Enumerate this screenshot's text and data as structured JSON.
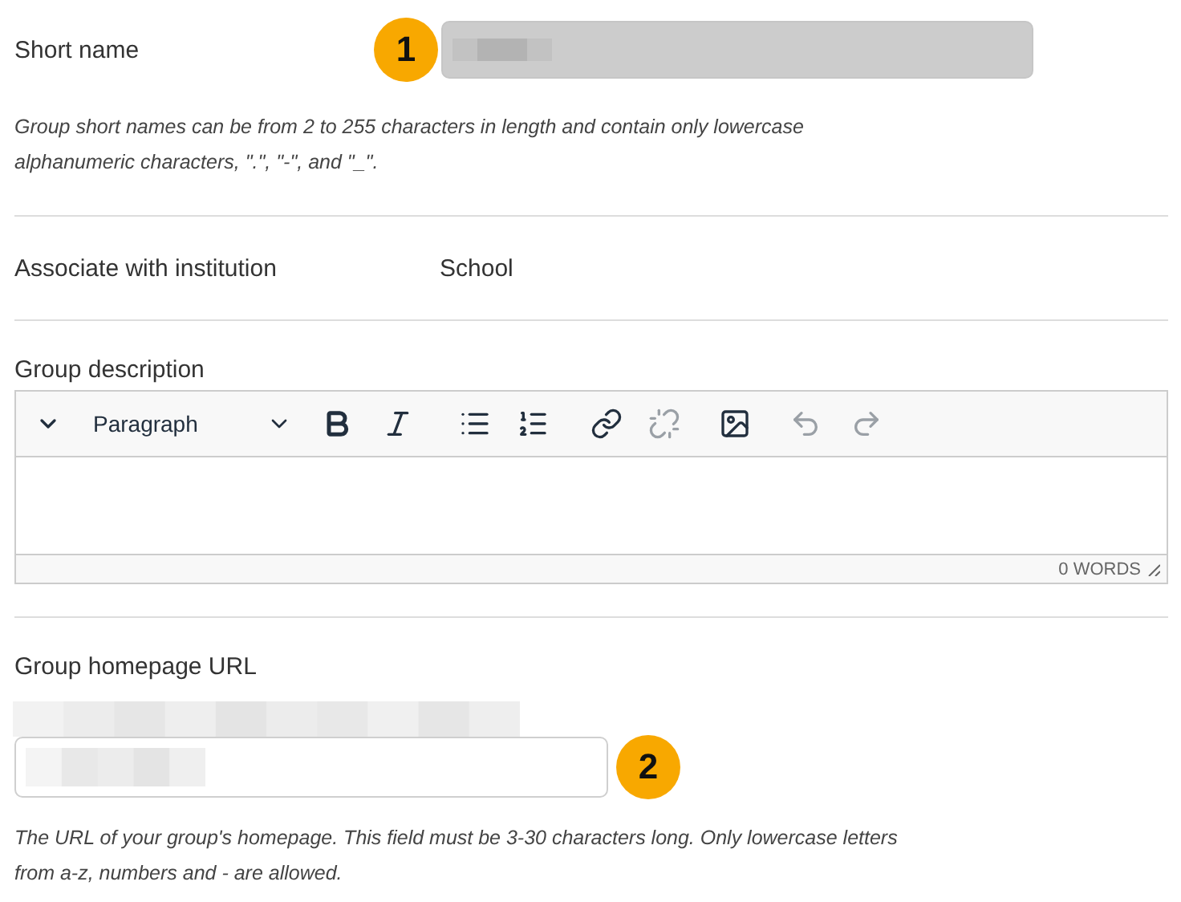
{
  "short_name": {
    "label": "Short name",
    "disabled": true,
    "callout": "1"
  },
  "short_name_help": "Group short names can be from 2 to 255 characters in length and contain only lowercase alphanumeric characters, \".\", \"-\", and \"_\".",
  "institution": {
    "label": "Associate with institution",
    "value": "School"
  },
  "description": {
    "label": "Group description",
    "toolbar": [
      {
        "kind": "collapse",
        "disabled": false
      },
      {
        "kind": "format",
        "label": "Paragraph",
        "disabled": false
      },
      {
        "kind": "bold",
        "disabled": false
      },
      {
        "kind": "italic",
        "disabled": false
      },
      {
        "kind": "bullets",
        "disabled": false
      },
      {
        "kind": "numbers",
        "disabled": false
      },
      {
        "kind": "link",
        "disabled": false
      },
      {
        "kind": "unlink",
        "disabled": true
      },
      {
        "kind": "image",
        "disabled": false
      },
      {
        "kind": "undo",
        "disabled": true
      },
      {
        "kind": "redo",
        "disabled": true
      }
    ],
    "word_count": "0 WORDS"
  },
  "homepage": {
    "label": "Group homepage URL",
    "disabled": false,
    "callout": "2"
  },
  "homepage_help": "The URL of your group's homepage. This field must be 3-30 characters long. Only lowercase letters from a-z, numbers and - are allowed."
}
